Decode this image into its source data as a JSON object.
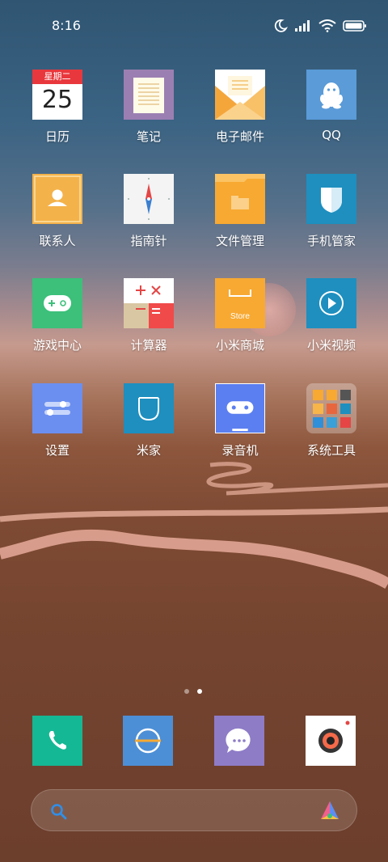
{
  "status_bar": {
    "time": "8:16"
  },
  "apps": {
    "calendar": {
      "label": "日历",
      "weekday": "星期二",
      "day": "25"
    },
    "notes": {
      "label": "笔记"
    },
    "email": {
      "label": "电子邮件"
    },
    "qq": {
      "label": "QQ"
    },
    "contacts": {
      "label": "联系人"
    },
    "compass": {
      "label": "指南针"
    },
    "files": {
      "label": "文件管理"
    },
    "security": {
      "label": "手机管家"
    },
    "games": {
      "label": "游戏中心"
    },
    "calculator": {
      "label": "计算器"
    },
    "store": {
      "label": "小米商城",
      "icon_text": "Store"
    },
    "video": {
      "label": "小米视频"
    },
    "settings": {
      "label": "设置"
    },
    "mihome": {
      "label": "米家"
    },
    "recorder": {
      "label": "录音机"
    },
    "tools": {
      "label": "系统工具"
    }
  },
  "pager": {
    "pages": 2,
    "active": 2
  },
  "dock": [
    "phone-icon",
    "browser-icon",
    "messages-icon",
    "camera-icon"
  ],
  "colors": {
    "calendar_red": "#e8383d",
    "notes_purple": "#9c7fb2",
    "email_orange": "#f7b54a",
    "qq_blue": "#5a9bd8",
    "contacts_orange": "#f4b24a",
    "files_orange": "#f7a932",
    "security_blue": "#1e8fbf",
    "games_green": "#3cc07a",
    "store_orange": "#f7a932",
    "video_blue": "#1e8fbf",
    "settings_blue": "#6b8ff0",
    "mihome_blue": "#1e8fbf",
    "recorder_blue": "#5b7ff0",
    "phone_green": "#15b894",
    "browser_blue": "#4d8fd6",
    "messages_purple": "#8e7cc7"
  }
}
